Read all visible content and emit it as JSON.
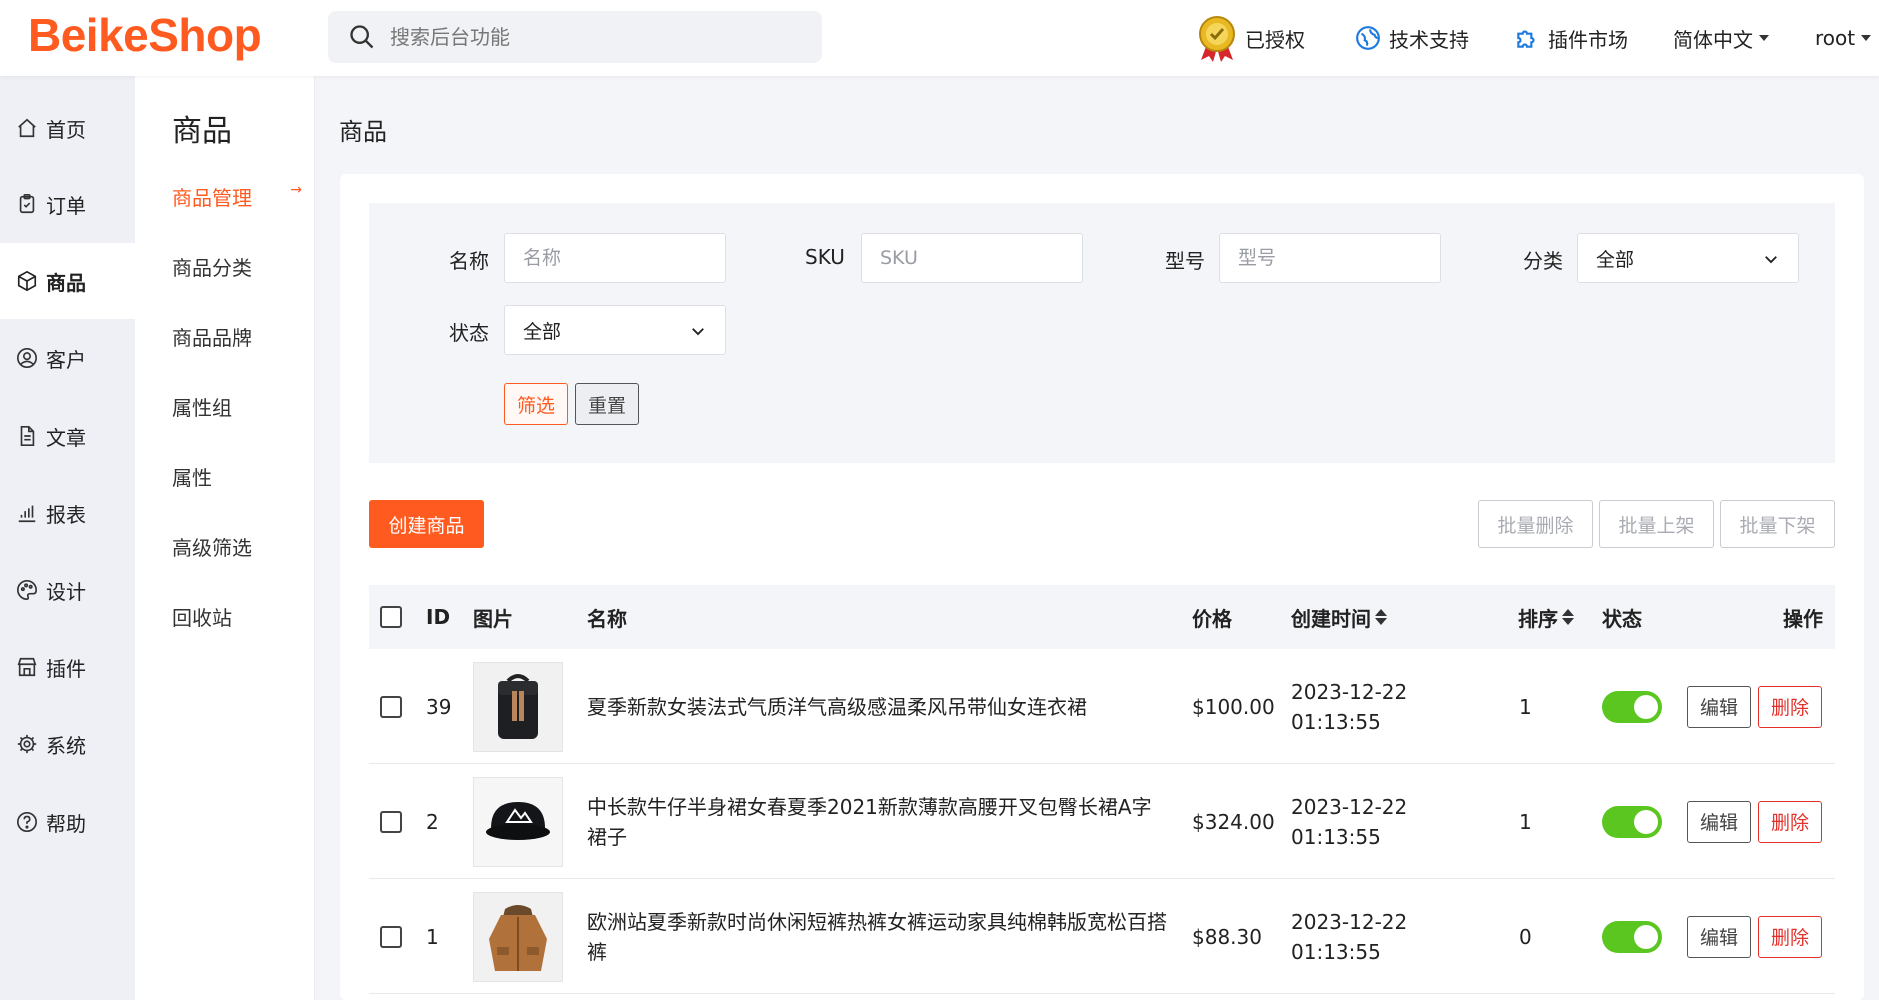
{
  "brand": {
    "logo": "BeikeShop",
    "accent": "#ff5a1f"
  },
  "header": {
    "search_placeholder": "搜索后台功能",
    "authorized": "已授权",
    "support": "技术支持",
    "plugins_market": "插件市场",
    "language": "简体中文",
    "user": "root"
  },
  "sidebar": {
    "items": [
      {
        "label": "首页",
        "icon": "home-icon"
      },
      {
        "label": "订单",
        "icon": "clipboard-icon"
      },
      {
        "label": "商品",
        "icon": "box-icon"
      },
      {
        "label": "客户",
        "icon": "user-circle-icon"
      },
      {
        "label": "文章",
        "icon": "document-icon"
      },
      {
        "label": "报表",
        "icon": "bar-chart-icon"
      },
      {
        "label": "设计",
        "icon": "palette-icon"
      },
      {
        "label": "插件",
        "icon": "store-icon"
      },
      {
        "label": "系统",
        "icon": "gear-icon"
      },
      {
        "label": "帮助",
        "icon": "question-icon"
      }
    ],
    "active": "商品"
  },
  "subnav": {
    "title": "商品",
    "items": [
      "商品管理",
      "商品分类",
      "商品品牌",
      "属性组",
      "属性",
      "高级筛选",
      "回收站"
    ],
    "active_arrow": "→"
  },
  "page": {
    "title": "商品"
  },
  "filter": {
    "name_label": "名称",
    "name_placeholder": "名称",
    "sku_label": "SKU",
    "sku_placeholder": "SKU",
    "model_label": "型号",
    "model_placeholder": "型号",
    "category_label": "分类",
    "category_value": "全部",
    "status_label": "状态",
    "status_value": "全部",
    "filter_button": "筛选",
    "reset_button": "重置"
  },
  "actions": {
    "create": "创建商品",
    "batch_delete": "批量删除",
    "batch_on": "批量上架",
    "batch_off": "批量下架"
  },
  "table": {
    "headers": {
      "id": "ID",
      "image": "图片",
      "name": "名称",
      "price": "价格",
      "created": "创建时间",
      "sort": "排序",
      "status": "状态",
      "ops": "操作"
    },
    "edit_label": "编辑",
    "delete_label": "删除",
    "rows": [
      {
        "id": "39",
        "name": "夏季新款女装法式气质洋气高级感温柔风吊带仙女连衣裙",
        "price": "$100.00",
        "date": "2023-12-22",
        "time": "01:13:55",
        "sort": "1",
        "status_on": true,
        "image": "backpack"
      },
      {
        "id": "2",
        "name": "中长款牛仔半身裙女春夏季2021新款薄款高腰开叉包臀长裙A字裙子",
        "price": "$324.00",
        "date": "2023-12-22",
        "time": "01:13:55",
        "sort": "1",
        "status_on": true,
        "image": "cap"
      },
      {
        "id": "1",
        "name": "欧洲站夏季新款时尚休闲短裤热裤女裤运动家具纯棉韩版宽松百搭裤",
        "price": "$88.30",
        "date": "2023-12-22",
        "time": "01:13:55",
        "sort": "0",
        "status_on": true,
        "image": "jacket"
      }
    ]
  }
}
